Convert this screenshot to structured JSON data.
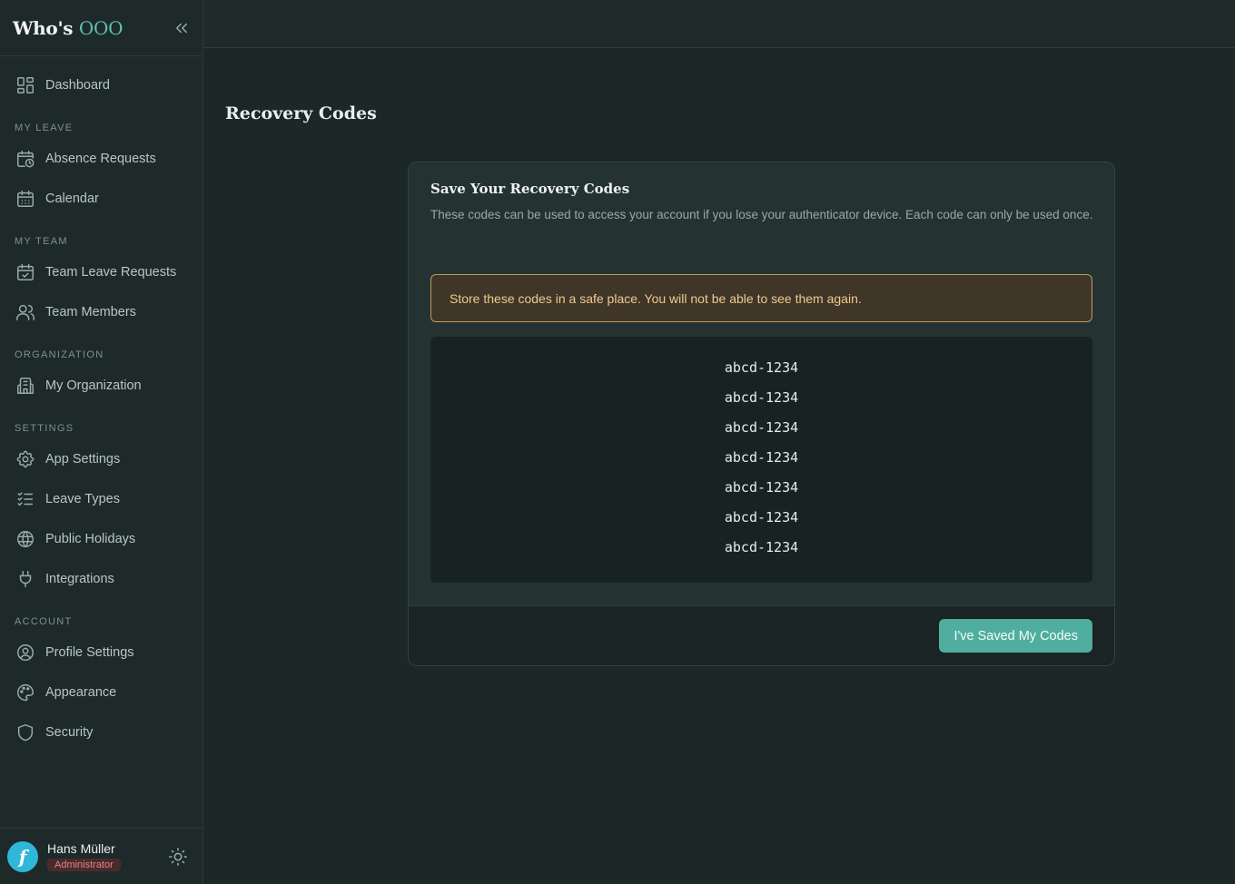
{
  "brand": {
    "name": "Who's",
    "suffix": "OOO"
  },
  "sidebar": {
    "items": [
      {
        "label": "Dashboard",
        "icon": "dashboard-icon"
      },
      {
        "label": "Absence Requests",
        "icon": "calendar-clock-icon"
      },
      {
        "label": "Calendar",
        "icon": "calendar-icon"
      },
      {
        "label": "Team Leave Requests",
        "icon": "calendar-check-icon"
      },
      {
        "label": "Team Members",
        "icon": "users-icon"
      },
      {
        "label": "My Organization",
        "icon": "building-icon"
      },
      {
        "label": "App Settings",
        "icon": "gear-icon"
      },
      {
        "label": "Leave Types",
        "icon": "list-check-icon"
      },
      {
        "label": "Public Holidays",
        "icon": "globe-icon"
      },
      {
        "label": "Integrations",
        "icon": "plug-icon"
      },
      {
        "label": "Profile Settings",
        "icon": "user-circle-icon"
      },
      {
        "label": "Appearance",
        "icon": "palette-icon"
      },
      {
        "label": "Security",
        "icon": "shield-icon"
      }
    ],
    "sections": [
      "My Leave",
      "My Team",
      "Organization",
      "Settings",
      "Account"
    ]
  },
  "user": {
    "name": "Hans Müller",
    "role": "Administrator",
    "avatar_letter": "f"
  },
  "page": {
    "title": "Recovery Codes"
  },
  "card": {
    "title": "Save Your Recovery Codes",
    "description": "These codes can be used to access your account if you lose your authenticator device. Each code can only be used once.",
    "warning": "Store these codes in a safe place. You will not be able to see them again.",
    "codes": [
      "abcd-1234",
      "abcd-1234",
      "abcd-1234",
      "abcd-1234",
      "abcd-1234",
      "abcd-1234",
      "abcd-1234"
    ],
    "button_label": "I've Saved My Codes"
  },
  "colors": {
    "accent": "#4fae9f",
    "warning_border": "#bf9a5c",
    "background": "#1c2727"
  }
}
